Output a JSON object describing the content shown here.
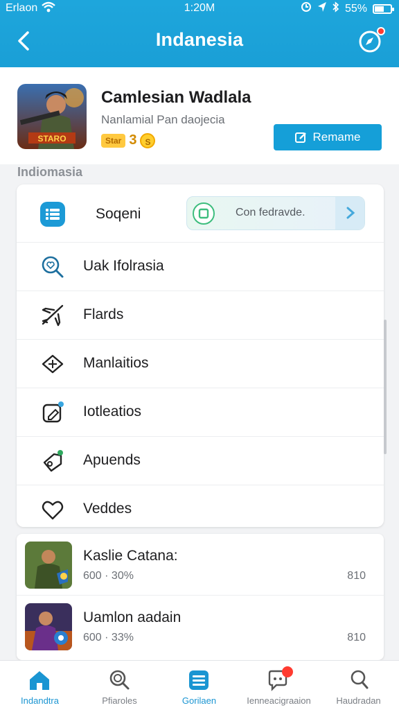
{
  "status": {
    "carrier": "Erlaon",
    "time": "1:20M",
    "battery": "55%",
    "battery_level": 0.55
  },
  "header": {
    "title": "Indanesia"
  },
  "game": {
    "name": "Camlesian Wadlala",
    "subtitle": "Nanlamial Pan daojecia",
    "art_text": "STARO",
    "badge": "Star",
    "badge_num": "3",
    "coin": "S",
    "button_label": "Remame"
  },
  "section_label": "Indiomasia",
  "menu": {
    "top": {
      "label": "Soqeni",
      "pill_text": "Con fedravde."
    },
    "items": [
      {
        "label": "Uak Ifolrasia",
        "icon": "search-heart-icon"
      },
      {
        "label": "Flards",
        "icon": "plane-icon"
      },
      {
        "label": "Manlaitios",
        "icon": "ticket-icon"
      },
      {
        "label": "Iotleatios",
        "icon": "edit-card-icon"
      },
      {
        "label": "Apuends",
        "icon": "tag-icon"
      },
      {
        "label": "Veddes",
        "icon": "heart-icon"
      }
    ]
  },
  "list": [
    {
      "name": "Kaslie Catana:",
      "meta": "600 · 30%",
      "right": "810"
    },
    {
      "name": "Uamlon aadain",
      "meta": "600 · 33%",
      "right": "810"
    }
  ],
  "tabs": [
    {
      "label": "Indandtra",
      "icon": "home-icon",
      "active": true
    },
    {
      "label": "Pfiaroles",
      "icon": "search-icon",
      "active": false
    },
    {
      "label": "Gorilaen",
      "icon": "list-icon",
      "active": true
    },
    {
      "label": "Ienneacigraaion",
      "icon": "chat-icon",
      "active": false
    },
    {
      "label": "Haudradan",
      "icon": "person-icon",
      "active": false
    }
  ],
  "colors": {
    "brand": "#1ea6dc",
    "accent": "#159fd8",
    "badge": "#ff3b30"
  }
}
